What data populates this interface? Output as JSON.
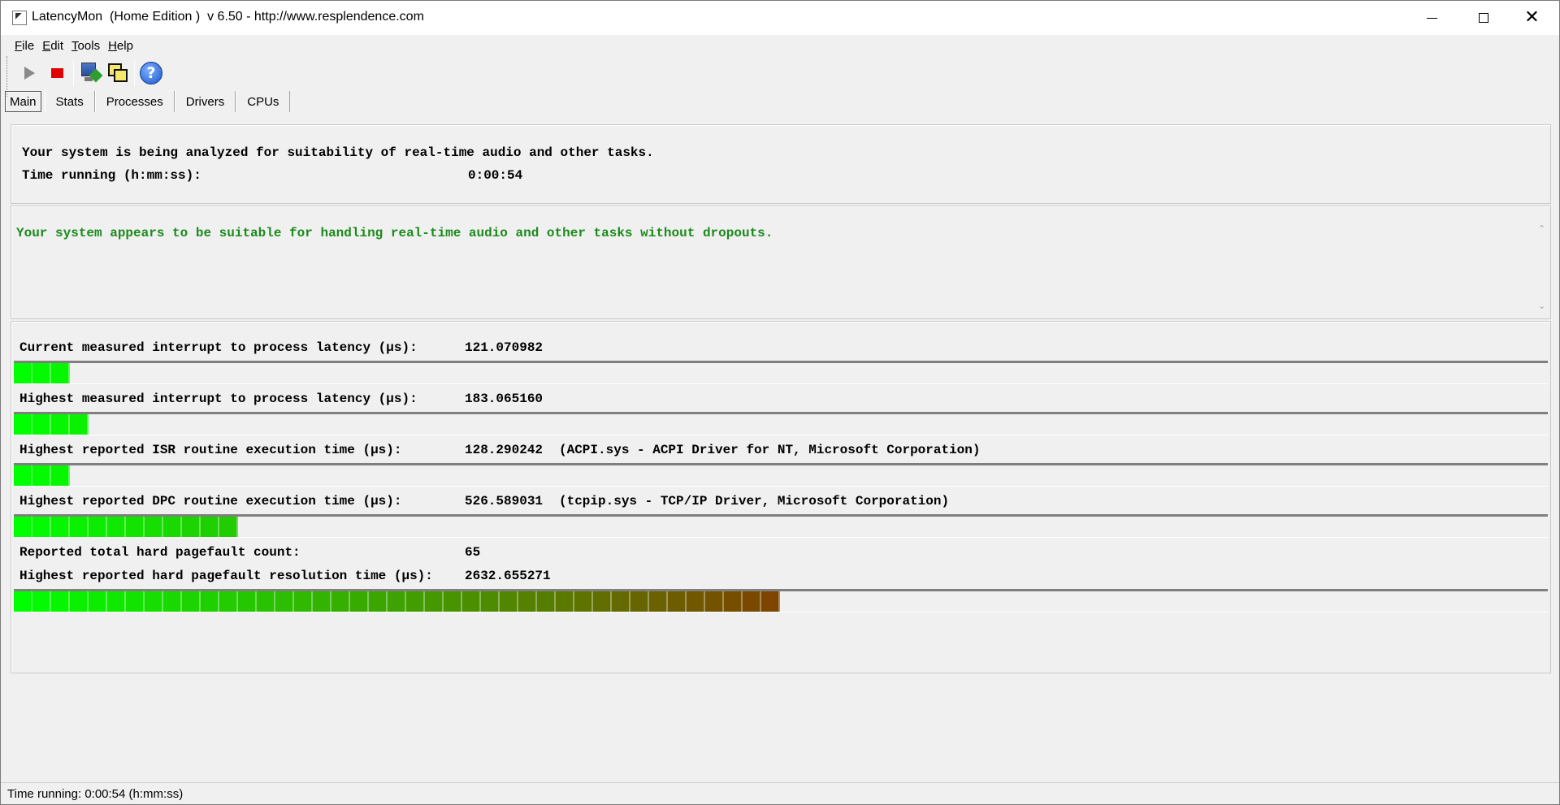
{
  "window": {
    "title": "LatencyMon  (Home Edition )  v 6.50 - http://www.resplendence.com"
  },
  "menu": [
    "File",
    "Edit",
    "Tools",
    "Help"
  ],
  "toolbar": {
    "icons": [
      "play-icon",
      "stop-icon",
      "monitor-icon",
      "windows-icon",
      "help-icon"
    ],
    "help_symbol": "?"
  },
  "tabs": [
    "Main",
    "Stats",
    "Processes",
    "Drivers",
    "CPUs"
  ],
  "status_panel": {
    "headline": "Your system is being analyzed for suitability of real-time audio and other tasks.",
    "time_label": "Time running (h:mm:ss):",
    "time_value": "0:00:54"
  },
  "verdict": {
    "text": "Your system appears to be suitable for handling real-time audio and other tasks without dropouts.",
    "color": "#1a8a1a"
  },
  "metrics": [
    {
      "label": "Current measured interrupt to process latency (µs):",
      "value": "121.070982",
      "detail": "",
      "bar_cells": 3
    },
    {
      "label": "Highest measured interrupt to process latency (µs):",
      "value": "183.065160",
      "detail": "",
      "bar_cells": 4
    },
    {
      "label": "Highest reported ISR routine execution time (µs):",
      "value": "128.290242",
      "detail": "(ACPI.sys - ACPI Driver for NT, Microsoft Corporation)",
      "bar_cells": 3
    },
    {
      "label": "Highest reported DPC routine execution time (µs):",
      "value": "526.589031",
      "detail": "(tcpip.sys - TCP/IP Driver, Microsoft Corporation)",
      "bar_cells": 12
    },
    {
      "label": "Reported total hard pagefault count:",
      "value": "65",
      "detail": "",
      "bar_cells": null
    },
    {
      "label": "Highest reported hard pagefault resolution time (µs):",
      "value": "2632.655271",
      "detail": "",
      "bar_cells": 41
    }
  ],
  "bar_colors": {
    "start": "#00ff00",
    "end": "#804000"
  },
  "statusbar": {
    "text": "Time running: 0:00:54  (h:mm:ss)"
  }
}
